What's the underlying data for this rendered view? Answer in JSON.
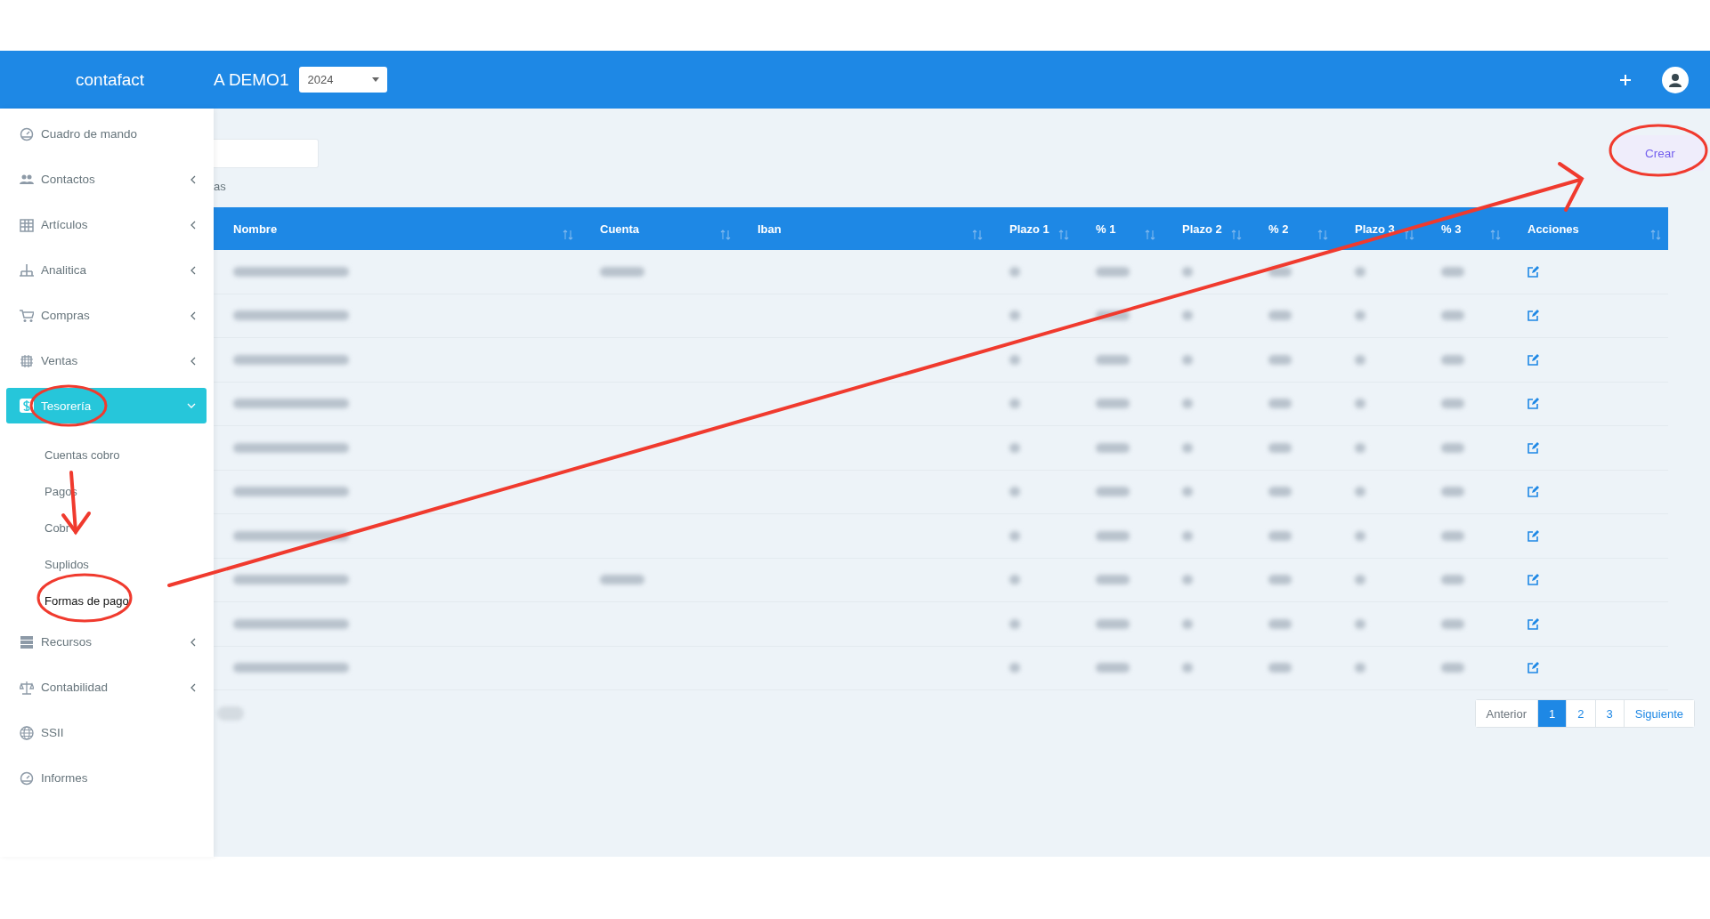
{
  "header": {
    "logo": "contafact",
    "company": "A DEMO1",
    "year_select": {
      "value": "2024"
    }
  },
  "sidebar": {
    "items": [
      {
        "label": "Cuadro de mando",
        "selected": false
      },
      {
        "label": "Contactos",
        "selected": false,
        "expanded": false
      },
      {
        "label": "Artículos",
        "selected": false,
        "expanded": false
      },
      {
        "label": "Analitica",
        "selected": false,
        "expanded": false
      },
      {
        "label": "Compras",
        "selected": false,
        "expanded": false
      },
      {
        "label": "Ventas",
        "selected": false,
        "expanded": false
      },
      {
        "label": "Tesorería",
        "selected": true,
        "expanded": true,
        "children": [
          {
            "label": "Cuentas cobro",
            "selected": false
          },
          {
            "label": "Pagos",
            "selected": false
          },
          {
            "label": "Cobr",
            "selected": false
          },
          {
            "label": "Suplidos",
            "selected": false
          },
          {
            "label": "Formas de pago",
            "selected": true
          }
        ]
      },
      {
        "label": "Recursos",
        "selected": false,
        "expanded": false
      },
      {
        "label": "Contabilidad",
        "selected": false,
        "expanded": false
      },
      {
        "label": "SSII",
        "selected": false
      },
      {
        "label": "Informes",
        "selected": false
      }
    ]
  },
  "content": {
    "caption": "as",
    "create_button": "Crear",
    "table": {
      "columns": [
        "Nombre",
        "Cuenta",
        "Iban",
        "Plazo 1",
        "% 1",
        "Plazo 2",
        "% 2",
        "Plazo 3",
        "% 3",
        "Acciones"
      ],
      "rows": [
        {
          "redacted": [
            true,
            true,
            false,
            true,
            true,
            true,
            true,
            true,
            true
          ]
        },
        {
          "redacted": [
            true,
            false,
            false,
            true,
            true,
            true,
            true,
            true,
            true
          ]
        },
        {
          "redacted": [
            true,
            false,
            false,
            true,
            true,
            true,
            true,
            true,
            true
          ]
        },
        {
          "redacted": [
            true,
            false,
            false,
            true,
            true,
            true,
            true,
            true,
            true
          ]
        },
        {
          "redacted": [
            true,
            false,
            false,
            true,
            true,
            true,
            true,
            true,
            true
          ]
        },
        {
          "redacted": [
            true,
            false,
            false,
            true,
            true,
            true,
            true,
            true,
            true
          ]
        },
        {
          "redacted": [
            true,
            false,
            false,
            true,
            true,
            true,
            true,
            true,
            true
          ]
        },
        {
          "redacted": [
            true,
            true,
            false,
            true,
            true,
            true,
            true,
            true,
            true
          ]
        },
        {
          "redacted": [
            true,
            false,
            false,
            true,
            true,
            true,
            true,
            true,
            true
          ]
        },
        {
          "redacted": [
            true,
            false,
            false,
            true,
            true,
            true,
            true,
            true,
            true
          ]
        }
      ]
    },
    "pagination": {
      "previous": "Anterior",
      "pages": [
        {
          "label": "1",
          "selected": true
        },
        {
          "label": "2",
          "selected": false
        },
        {
          "label": "3",
          "selected": false
        }
      ],
      "next": "Siguiente"
    }
  }
}
